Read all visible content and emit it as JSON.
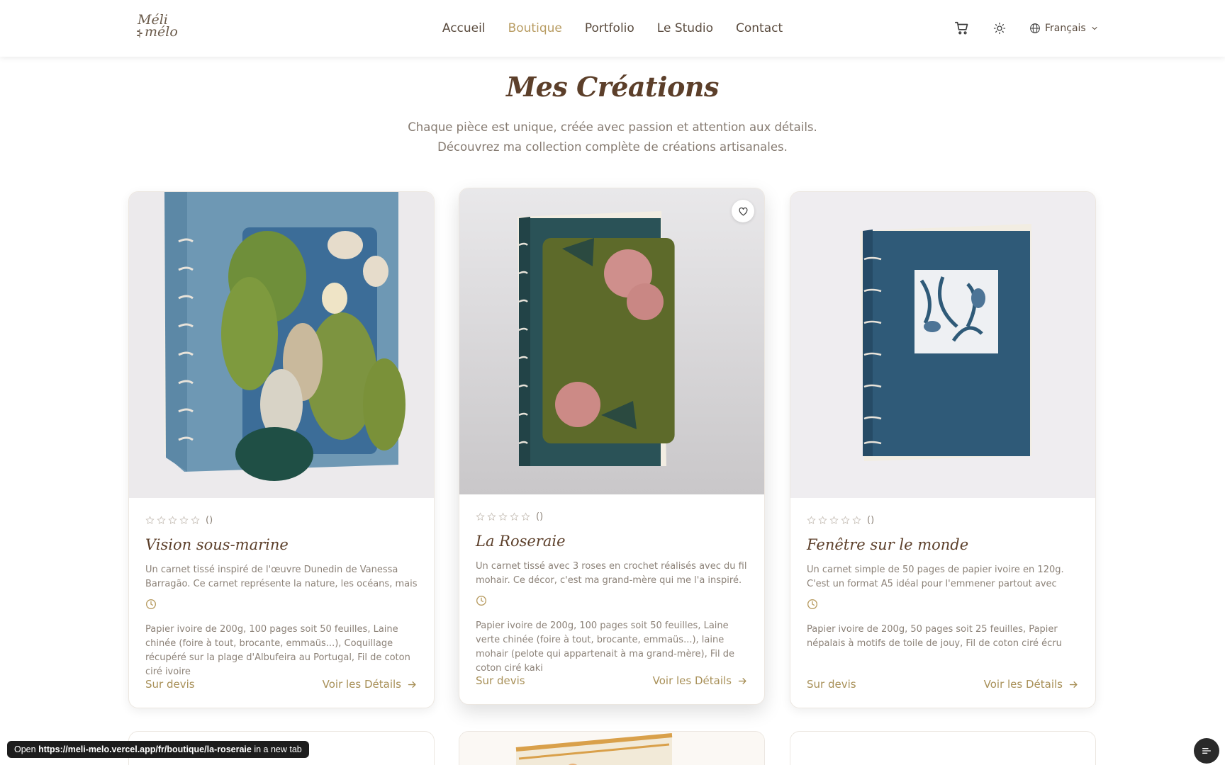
{
  "header": {
    "logo_line1": "Méli",
    "logo_line2": "mélo",
    "nav": [
      "Accueil",
      "Boutique",
      "Portfolio",
      "Le Studio",
      "Contact"
    ],
    "active_nav": "Boutique",
    "language": "Français"
  },
  "intro": {
    "title": "Mes Créations",
    "subtitle": "Chaque pièce est unique, créée avec passion et attention aux détails. Découvrez ma collection complète de créations artisanales."
  },
  "cards": [
    {
      "rating_count": "()",
      "title": "Vision sous-marine",
      "description": "Un carnet tissé inspiré de l'œuvre Dunedin de Vanessa Barragão. Ce carnet représente la nature, les océans, mais pour moi cela...",
      "materials": "Papier ivoire de 200g, 100 pages soit 50 feuilles, Laine chinée (foire à tout, brocante, emmaüs...), Coquillage récupéré sur la plage d'Albufeira au Portugal, Fil de coton ciré ivoire",
      "price": "Sur devis",
      "cta": "Voir les Détails"
    },
    {
      "rating_count": "()",
      "title": "La Roseraie",
      "description": "Un carnet tissé avec 3 roses en crochet réalisés avec du fil mohair. Ce décor, c'est ma grand-mère qui me l'a inspiré. Elle est passionn...",
      "materials": "Papier ivoire de 200g, 100 pages soit 50 feuilles, Laine verte chinée (foire à tout, brocante, emmaüs...), laine mohair (pelote qui appartenait à ma grand-mère), Fil de coton ciré kaki",
      "price": "Sur devis",
      "cta": "Voir les Détails"
    },
    {
      "rating_count": "()",
      "title": "Fenêtre sur le monde",
      "description": "Un carnet simple de 50 pages de papier ivoire en 120g. C'est un format A5 idéal pour l'emmener partout avec nous, que ce soit da...",
      "materials": "Papier ivoire de 200g, 50 pages soit 25 feuilles, Papier népalais à motifs de toile de jouy, Fil de coton ciré écru",
      "price": "Sur devis",
      "cta": "Voir les Détails"
    }
  ],
  "status_bar": {
    "prefix": "Open",
    "url": "https://meli-melo.vercel.app/fr/boutique/la-roseraie",
    "suffix": "in a new tab"
  },
  "colors": {
    "accent_gold": "#b89c62",
    "title_brown": "#5c3f2a",
    "body_text": "#8c8278"
  },
  "icons": [
    "cart-icon",
    "sun-icon",
    "globe-icon",
    "chevron-down-icon",
    "heart-icon",
    "star-icon",
    "clock-icon",
    "arrow-right-icon"
  ]
}
